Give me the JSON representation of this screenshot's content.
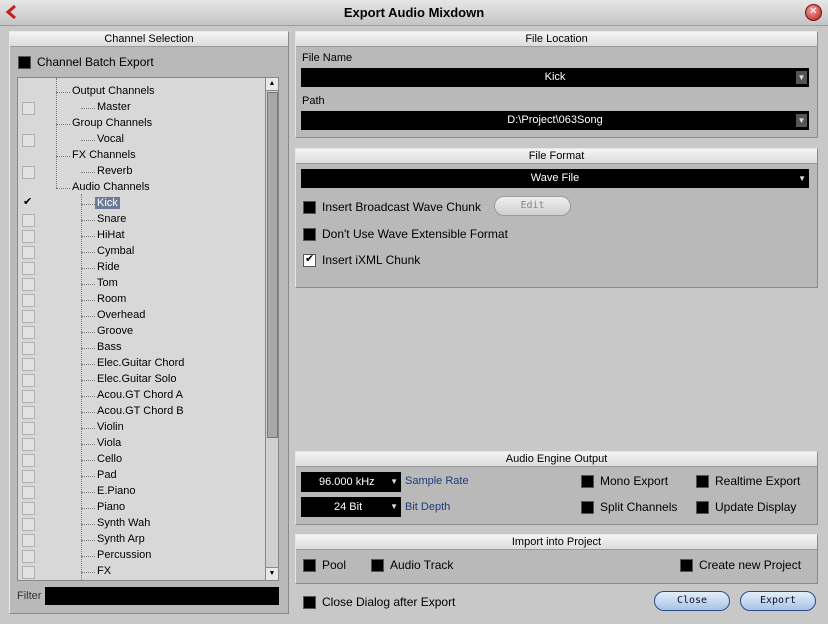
{
  "window": {
    "title": "Export Audio Mixdown"
  },
  "channel_selection": {
    "header": "Channel Selection",
    "batch_export_label": "Channel Batch Export",
    "filter_label": "Filter",
    "rows": [
      {
        "label": "Output Channels",
        "level": 0,
        "checkbox": false,
        "checked": false
      },
      {
        "label": "Master",
        "level": 1,
        "checkbox": true,
        "checked": false
      },
      {
        "label": "Group Channels",
        "level": 0,
        "checkbox": false,
        "checked": false
      },
      {
        "label": "Vocal",
        "level": 1,
        "checkbox": true,
        "checked": false
      },
      {
        "label": "FX Channels",
        "level": 0,
        "checkbox": false,
        "checked": false
      },
      {
        "label": "Reverb",
        "level": 1,
        "checkbox": true,
        "checked": false
      },
      {
        "label": "Audio Channels",
        "level": 0,
        "checkbox": false,
        "checked": false
      },
      {
        "label": "Kick",
        "level": 1,
        "checkbox": true,
        "checked": true,
        "selected": true
      },
      {
        "label": "Snare",
        "level": 1,
        "checkbox": true,
        "checked": false
      },
      {
        "label": "HiHat",
        "level": 1,
        "checkbox": true,
        "checked": false
      },
      {
        "label": "Cymbal",
        "level": 1,
        "checkbox": true,
        "checked": false
      },
      {
        "label": "Ride",
        "level": 1,
        "checkbox": true,
        "checked": false
      },
      {
        "label": "Tom",
        "level": 1,
        "checkbox": true,
        "checked": false
      },
      {
        "label": "Room",
        "level": 1,
        "checkbox": true,
        "checked": false
      },
      {
        "label": "Overhead",
        "level": 1,
        "checkbox": true,
        "checked": false
      },
      {
        "label": "Groove",
        "level": 1,
        "checkbox": true,
        "checked": false
      },
      {
        "label": "Bass",
        "level": 1,
        "checkbox": true,
        "checked": false
      },
      {
        "label": "Elec.Guitar Chord",
        "level": 1,
        "checkbox": true,
        "checked": false
      },
      {
        "label": "Elec.Guitar Solo",
        "level": 1,
        "checkbox": true,
        "checked": false
      },
      {
        "label": "Acou.GT Chord A",
        "level": 1,
        "checkbox": true,
        "checked": false
      },
      {
        "label": "Acou.GT Chord B",
        "level": 1,
        "checkbox": true,
        "checked": false
      },
      {
        "label": "Violin",
        "level": 1,
        "checkbox": true,
        "checked": false
      },
      {
        "label": "Viola",
        "level": 1,
        "checkbox": true,
        "checked": false
      },
      {
        "label": "Cello",
        "level": 1,
        "checkbox": true,
        "checked": false
      },
      {
        "label": "Pad",
        "level": 1,
        "checkbox": true,
        "checked": false
      },
      {
        "label": "E.Piano",
        "level": 1,
        "checkbox": true,
        "checked": false
      },
      {
        "label": "Piano",
        "level": 1,
        "checkbox": true,
        "checked": false
      },
      {
        "label": "Synth Wah",
        "level": 1,
        "checkbox": true,
        "checked": false
      },
      {
        "label": "Synth Arp",
        "level": 1,
        "checkbox": true,
        "checked": false
      },
      {
        "label": "Percussion",
        "level": 1,
        "checkbox": true,
        "checked": false
      },
      {
        "label": "FX",
        "level": 1,
        "checkbox": true,
        "checked": false
      }
    ]
  },
  "file_location": {
    "header": "File Location",
    "file_name_label": "File Name",
    "file_name_value": "Kick",
    "path_label": "Path",
    "path_value": "D:\\Project\\063Song"
  },
  "file_format": {
    "header": "File Format",
    "format_value": "Wave File",
    "broadcast_label": "Insert Broadcast Wave Chunk",
    "edit_label": "Edit",
    "wave_extensible_label": "Don't Use Wave Extensible Format",
    "ixml_label": "Insert iXML Chunk"
  },
  "audio_engine": {
    "header": "Audio Engine Output",
    "sample_rate_value": "96.000 kHz",
    "sample_rate_label": "Sample Rate",
    "bit_depth_value": "24 Bit",
    "bit_depth_label": "Bit Depth",
    "mono_export_label": "Mono Export",
    "split_channels_label": "Split Channels",
    "realtime_export_label": "Realtime Export",
    "update_display_label": "Update Display"
  },
  "import_project": {
    "header": "Import into Project",
    "pool_label": "Pool",
    "audio_track_label": "Audio Track",
    "new_project_label": "Create new Project"
  },
  "footer": {
    "close_dialog_label": "Close Dialog after Export",
    "close_button": "Close",
    "export_button": "Export"
  }
}
